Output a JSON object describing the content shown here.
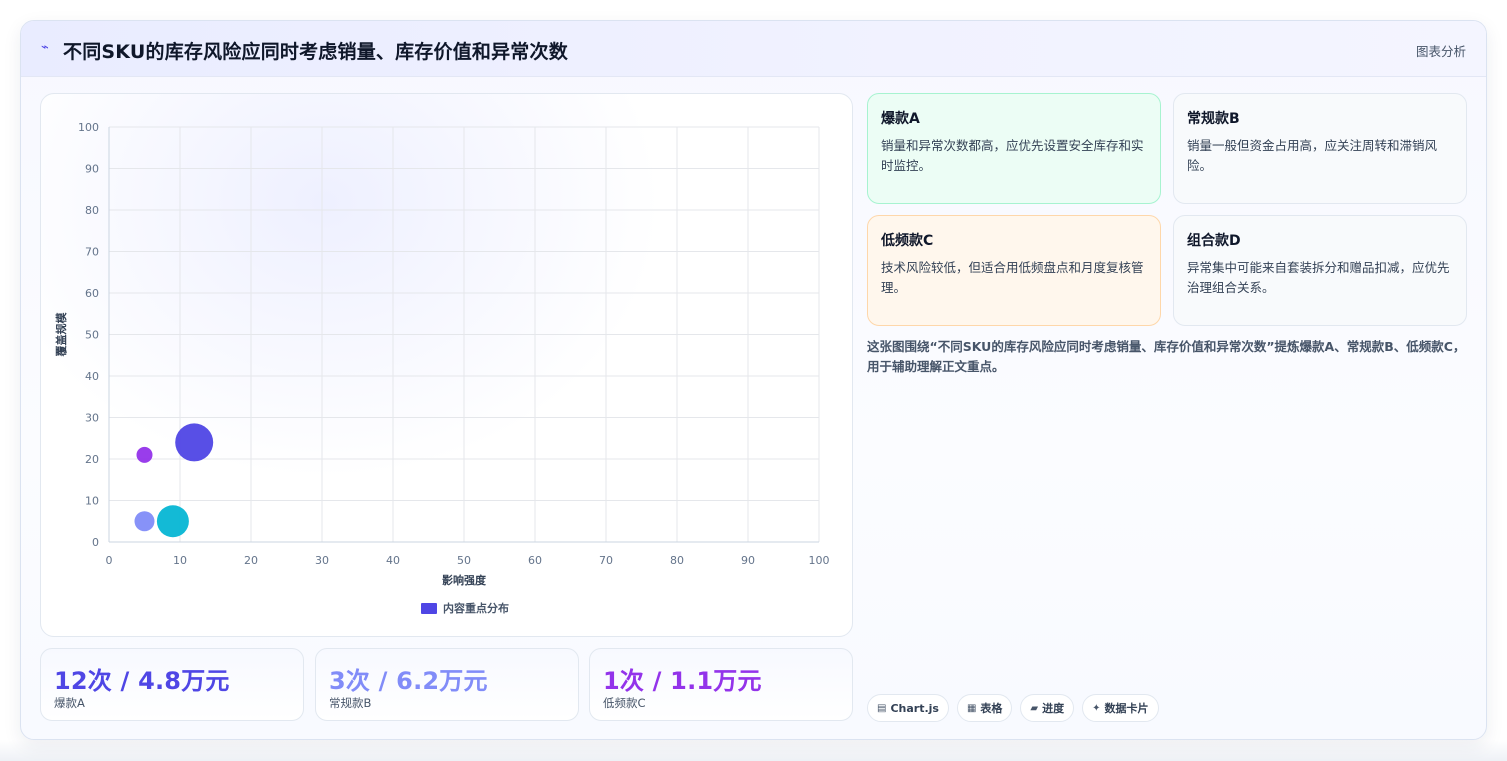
{
  "header": {
    "title": "不同SKU的库存风险应同时考虑销量、库存价值和异常次数",
    "tag": "图表分析"
  },
  "chart_data": {
    "type": "scatter",
    "bubble": true,
    "xlabel": "影响强度",
    "ylabel": "覆盖规模",
    "xlim": [
      0,
      100
    ],
    "ylim": [
      0,
      100
    ],
    "xticks": [
      0,
      10,
      20,
      30,
      40,
      50,
      60,
      70,
      80,
      90,
      100
    ],
    "yticks": [
      0,
      10,
      20,
      30,
      40,
      50,
      60,
      70,
      80,
      90,
      100
    ],
    "grid": true,
    "legend_position": "bottom",
    "series": [
      {
        "name": "内容重点分布",
        "color": "#4f46e5",
        "points": [
          {
            "x": 12,
            "y": 24,
            "r": 19,
            "color": "#4f46e5"
          },
          {
            "x": 5,
            "y": 21,
            "r": 8,
            "color": "#9333ea"
          },
          {
            "x": 5,
            "y": 5,
            "r": 10,
            "color": "#818cf8"
          },
          {
            "x": 9,
            "y": 5,
            "r": 16,
            "color": "#06b6d4"
          }
        ]
      }
    ]
  },
  "stats": [
    {
      "value": "12次 / 4.8万元",
      "label": "爆款A",
      "color": "#4f46e5"
    },
    {
      "value": "3次 / 6.2万元",
      "label": "常规款B",
      "color": "#818cf8"
    },
    {
      "value": "1次 / 1.1万元",
      "label": "低频款C",
      "color": "#9333ea"
    }
  ],
  "insights": [
    {
      "title": "爆款A",
      "text": "销量和异常次数都高，应优先设置安全库存和实时监控。",
      "bg": "#ecfdf5",
      "border": "#a7f3d0"
    },
    {
      "title": "常规款B",
      "text": "销量一般但资金占用高，应关注周转和滞销风险。",
      "bg": "#f8fafc",
      "border": "#e2e8f0"
    },
    {
      "title": "低频款C",
      "text": "技术风险较低，但适合用低频盘点和月度复核管理。",
      "bg": "#fff7ed",
      "border": "#fed7aa"
    },
    {
      "title": "组合款D",
      "text": "异常集中可能来自套装拆分和赠品扣减，应优先治理组合关系。",
      "bg": "#f8fafc",
      "border": "#e2e8f0"
    }
  ],
  "summary": "这张图围绕“不同SKU的库存风险应同时考虑销量、库存价值和异常次数”提炼爆款A、常规款B、低频款C，用于辅助理解正文重点。",
  "chips": [
    {
      "icon": "chart-icon",
      "glyph": "▤",
      "label": "Chart.js"
    },
    {
      "icon": "table-icon",
      "glyph": "▦",
      "label": "表格"
    },
    {
      "icon": "progress-icon",
      "glyph": "▰",
      "label": "进度"
    },
    {
      "icon": "sparkle-icon",
      "glyph": "✦",
      "label": "数据卡片"
    }
  ]
}
